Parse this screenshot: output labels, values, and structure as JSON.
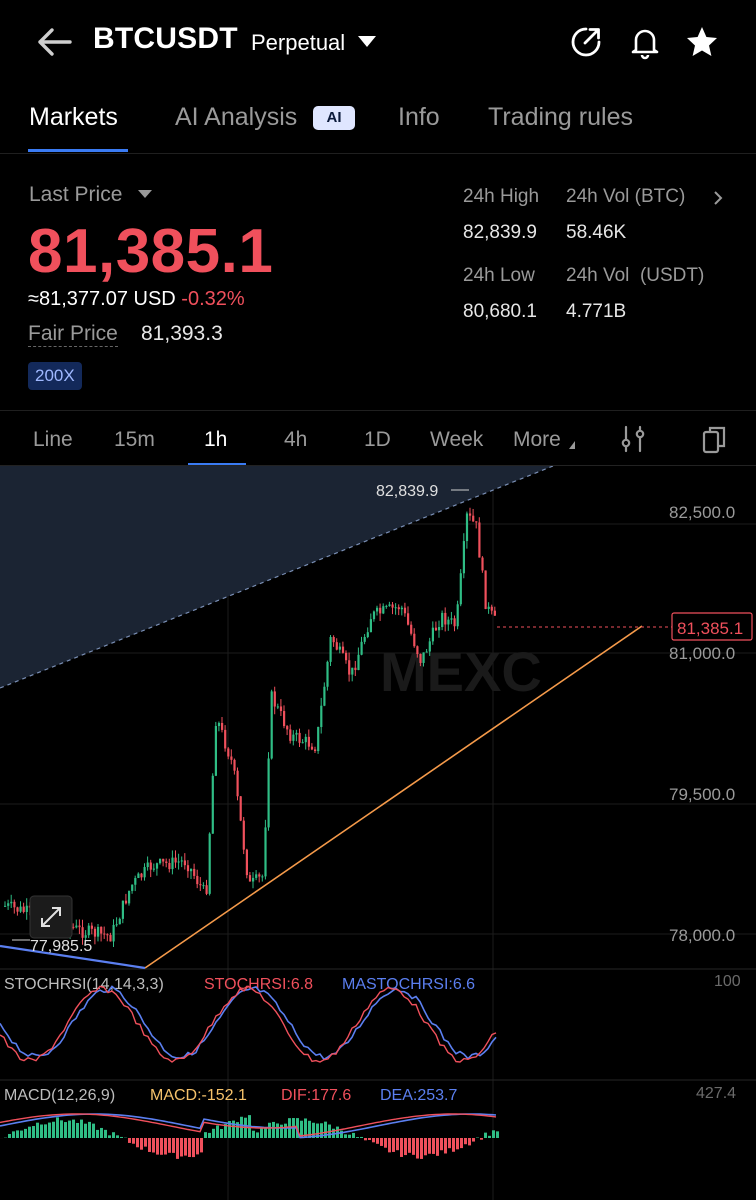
{
  "header": {
    "symbol": "BTCUSDT",
    "contract_type": "Perpetual",
    "icons": [
      "back-arrow-icon",
      "share-icon",
      "bell-icon",
      "star-icon"
    ]
  },
  "tabs": [
    {
      "label": "Markets",
      "active": true
    },
    {
      "label": "AI Analysis",
      "badge": "AI"
    },
    {
      "label": "Info"
    },
    {
      "label": "Trading rules"
    }
  ],
  "price": {
    "last_price_label": "Last Price",
    "last_price": "81,385.1",
    "usd_equiv": "≈81,377.07 USD",
    "change": "-0.32%",
    "fair_label": "Fair Price",
    "fair_value": "81,393.3",
    "leverage": "200X"
  },
  "stats": {
    "high_label": "24h High",
    "high_value": "82,839.9",
    "vol_btc_label": "24h Vol (BTC)",
    "vol_btc_value": "58.46K",
    "low_label": "24h Low",
    "low_value": "80,680.1",
    "vol_usdt_label": "24h Vol  (USDT)",
    "vol_usdt_value": "4.771B"
  },
  "intervals": [
    "Line",
    "15m",
    "1h",
    "4h",
    "1D",
    "Week",
    "More"
  ],
  "active_interval": "1h",
  "chart": {
    "y_ticks": [
      "82,500.0",
      "81,000.0",
      "79,500.0",
      "78,000.0"
    ],
    "high_marker": "82,839.9",
    "low_marker": "77,985.5",
    "current_tag": "81,385.1",
    "watermark": "MEXC",
    "stoch_title": "STOCHRSI(14,14,3,3)",
    "stoch_value": "STOCHRSI:6.8",
    "mastoch_value": "MASTOCHRSI:6.6",
    "stoch_axis": "100",
    "macd_title": "MACD(12,26,9)",
    "macd_value": "MACD:-152.1",
    "dif_value": "DIF:177.6",
    "dea_value": "DEA:253.7",
    "macd_axis": "427.4",
    "colors": {
      "up": "#2fbd85",
      "down": "#f0505c",
      "orange": "#f59a4a",
      "blue": "#5b7ff0"
    }
  }
}
